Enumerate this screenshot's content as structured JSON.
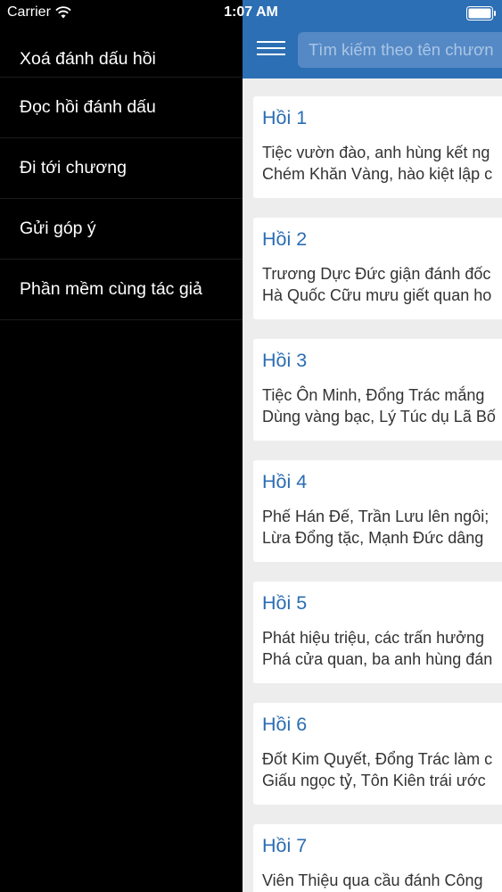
{
  "status_bar": {
    "carrier": "Carrier",
    "time": "1:07 AM",
    "wifi_icon": "wifi-icon",
    "battery_icon": "battery-icon"
  },
  "drawer": {
    "items": [
      {
        "label": "Xoá đánh dấu hồi"
      },
      {
        "label": "Đọc hồi đánh dấu"
      },
      {
        "label": "Đi tới chương"
      },
      {
        "label": "Gửi góp ý"
      },
      {
        "label": "Phần mềm cùng tác giả"
      }
    ]
  },
  "nav": {
    "menu_icon": "hamburger-menu-icon",
    "search_placeholder": "Tìm kiếm theo tên chươn"
  },
  "colors": {
    "nav_bg": "#2c6fb4",
    "search_bg": "#5589c5",
    "title_blue": "#2b6db3",
    "drawer_bg": "#000000",
    "content_bg": "#ededed"
  },
  "chapters": [
    {
      "title": "Hồi 1",
      "line1": "Tiệc vườn đào, anh hùng kết ng",
      "line2": "Chém Khăn Vàng, hào kiệt lập c"
    },
    {
      "title": "Hồi 2",
      "line1": "Trương Dực Đức giận đánh đốc",
      "line2": "Hà Quốc Cữu mưu giết quan ho"
    },
    {
      "title": "Hồi 3",
      "line1": "Tiệc Ôn Minh, Đổng Trác mắng",
      "line2": "Dùng vàng bạc, Lý Túc dụ Lã Bố"
    },
    {
      "title": "Hồi 4",
      "line1": "Phế Hán Đế, Trần Lưu lên ngôi;",
      "line2": "Lừa Đổng tặc, Mạnh Đức dâng"
    },
    {
      "title": "Hồi 5",
      "line1": "Phát hiệu triệu, các trấn hưởng",
      "line2": "Phá cửa quan, ba anh hùng đán"
    },
    {
      "title": "Hồi 6",
      "line1": "Đốt Kim Quyết, Đổng Trác làm c",
      "line2": "Giấu ngọc tỷ, Tôn Kiên trái ước"
    },
    {
      "title": "Hồi 7",
      "line1": "Viên Thiệu qua cầu đánh Công",
      "line2": ""
    }
  ]
}
